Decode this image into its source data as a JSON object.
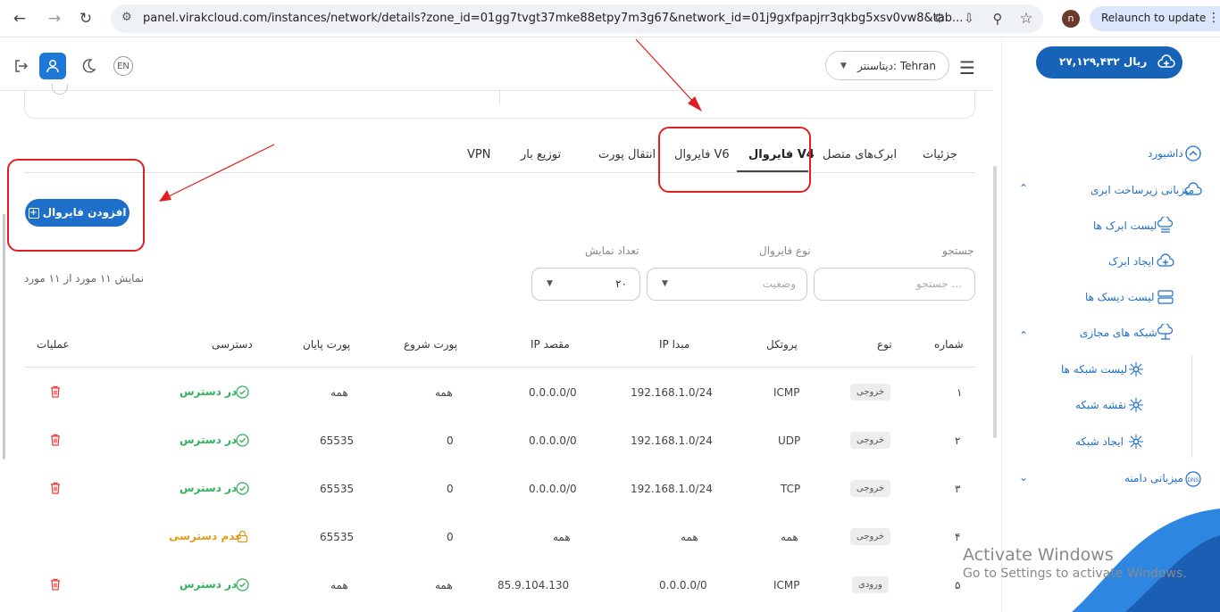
{
  "browser": {
    "url": "panel.virakcloud.com/instances/network/details?zone_id=01gg7tvgt37mke88etpy7m3g67&network_id=01j9gxfpapjrr3qkbg5xsv0vw8&tab...",
    "relaunch_label": "Relaunch to update",
    "profile_initial": "n"
  },
  "header": {
    "lang_label": "EN",
    "datacenter_label": "دیتاسنتر: Tehran"
  },
  "tabs": [
    {
      "label": "جزئیات",
      "active": false
    },
    {
      "label": "ابرک‌های متصل",
      "active": false
    },
    {
      "label": "فایروال V4",
      "active": true
    },
    {
      "label": "فایروال V6",
      "active": false
    },
    {
      "label": "انتقال پورت",
      "active": false
    },
    {
      "label": "توزیع بار",
      "active": false
    },
    {
      "label": "VPN",
      "active": false
    }
  ],
  "add_button_label": "افزودن فایروال",
  "filters": {
    "search_label": "جستجو",
    "search_placeholder": "جستجو ...",
    "type_label": "نوع فایروال",
    "type_placeholder": "وضعیت",
    "count_label": "تعداد نمایش",
    "count_value": "۲۰",
    "showing_text": "نمایش ۱۱ مورد از ۱۱ مورد"
  },
  "table": {
    "headers": [
      "شماره",
      "نوع",
      "پروتکل",
      "IP مبدا",
      "IP مقصد",
      "پورت شروع",
      "پورت پایان",
      "دسترسی",
      "عملیات"
    ],
    "rows": [
      {
        "num": "۱",
        "type": "خروجی",
        "protocol": "ICMP",
        "src": "192.168.1.0/24",
        "dst": "0.0.0.0/0",
        "start": "همه",
        "end": "همه",
        "access": "در دسترس",
        "access_ok": true,
        "deletable": true
      },
      {
        "num": "۲",
        "type": "خروجی",
        "protocol": "UDP",
        "src": "192.168.1.0/24",
        "dst": "0.0.0.0/0",
        "start": "0",
        "end": "65535",
        "access": "در دسترس",
        "access_ok": true,
        "deletable": true
      },
      {
        "num": "۳",
        "type": "خروجی",
        "protocol": "TCP",
        "src": "192.168.1.0/24",
        "dst": "0.0.0.0/0",
        "start": "0",
        "end": "65535",
        "access": "در دسترس",
        "access_ok": true,
        "deletable": true
      },
      {
        "num": "۴",
        "type": "خروجی",
        "protocol": "همه",
        "src": "همه",
        "dst": "همه",
        "start": "0",
        "end": "65535",
        "access": "عدم دسترسی",
        "access_ok": false,
        "deletable": false
      },
      {
        "num": "۵",
        "type": "ورودی",
        "protocol": "ICMP",
        "src": "0.0.0.0/0",
        "dst": "85.9.104.130",
        "start": "همه",
        "end": "همه",
        "access": "در دسترس",
        "access_ok": true,
        "deletable": true
      }
    ]
  },
  "sidebar": {
    "balance": "۲۷,۱۲۹,۴۳۲ ریال",
    "items": [
      {
        "label": "داشبورد",
        "icon": "dashboard-icon"
      },
      {
        "label": "میزبانی زیرساخت ابری",
        "icon": "cloud-icon",
        "expanded": true
      },
      {
        "label": "لیست ابرک ها",
        "icon": "cloud-list-icon"
      },
      {
        "label": "ایجاد ابرک",
        "icon": "cloud-add-icon"
      },
      {
        "label": "لیست دیسک ها",
        "icon": "disk-icon"
      },
      {
        "label": "شبکه های مجازی",
        "icon": "network-icon",
        "expanded": true
      },
      {
        "label": "لیست شبکه ها",
        "icon": "network-list-icon"
      },
      {
        "label": "نقشه شبکه",
        "icon": "network-map-icon"
      },
      {
        "label": "ایجاد شبکه",
        "icon": "network-add-icon"
      },
      {
        "label": "میزبانی دامنه",
        "icon": "dns-icon",
        "expanded": false
      }
    ]
  },
  "watermark": {
    "line1": "Activate Windows",
    "line2": "Go to Settings to activate Windows."
  },
  "colors": {
    "primary": "#1e6fc9",
    "success": "#2fb35a",
    "warning": "#e39a14",
    "danger": "#e53935",
    "annotation": "#e02020"
  }
}
